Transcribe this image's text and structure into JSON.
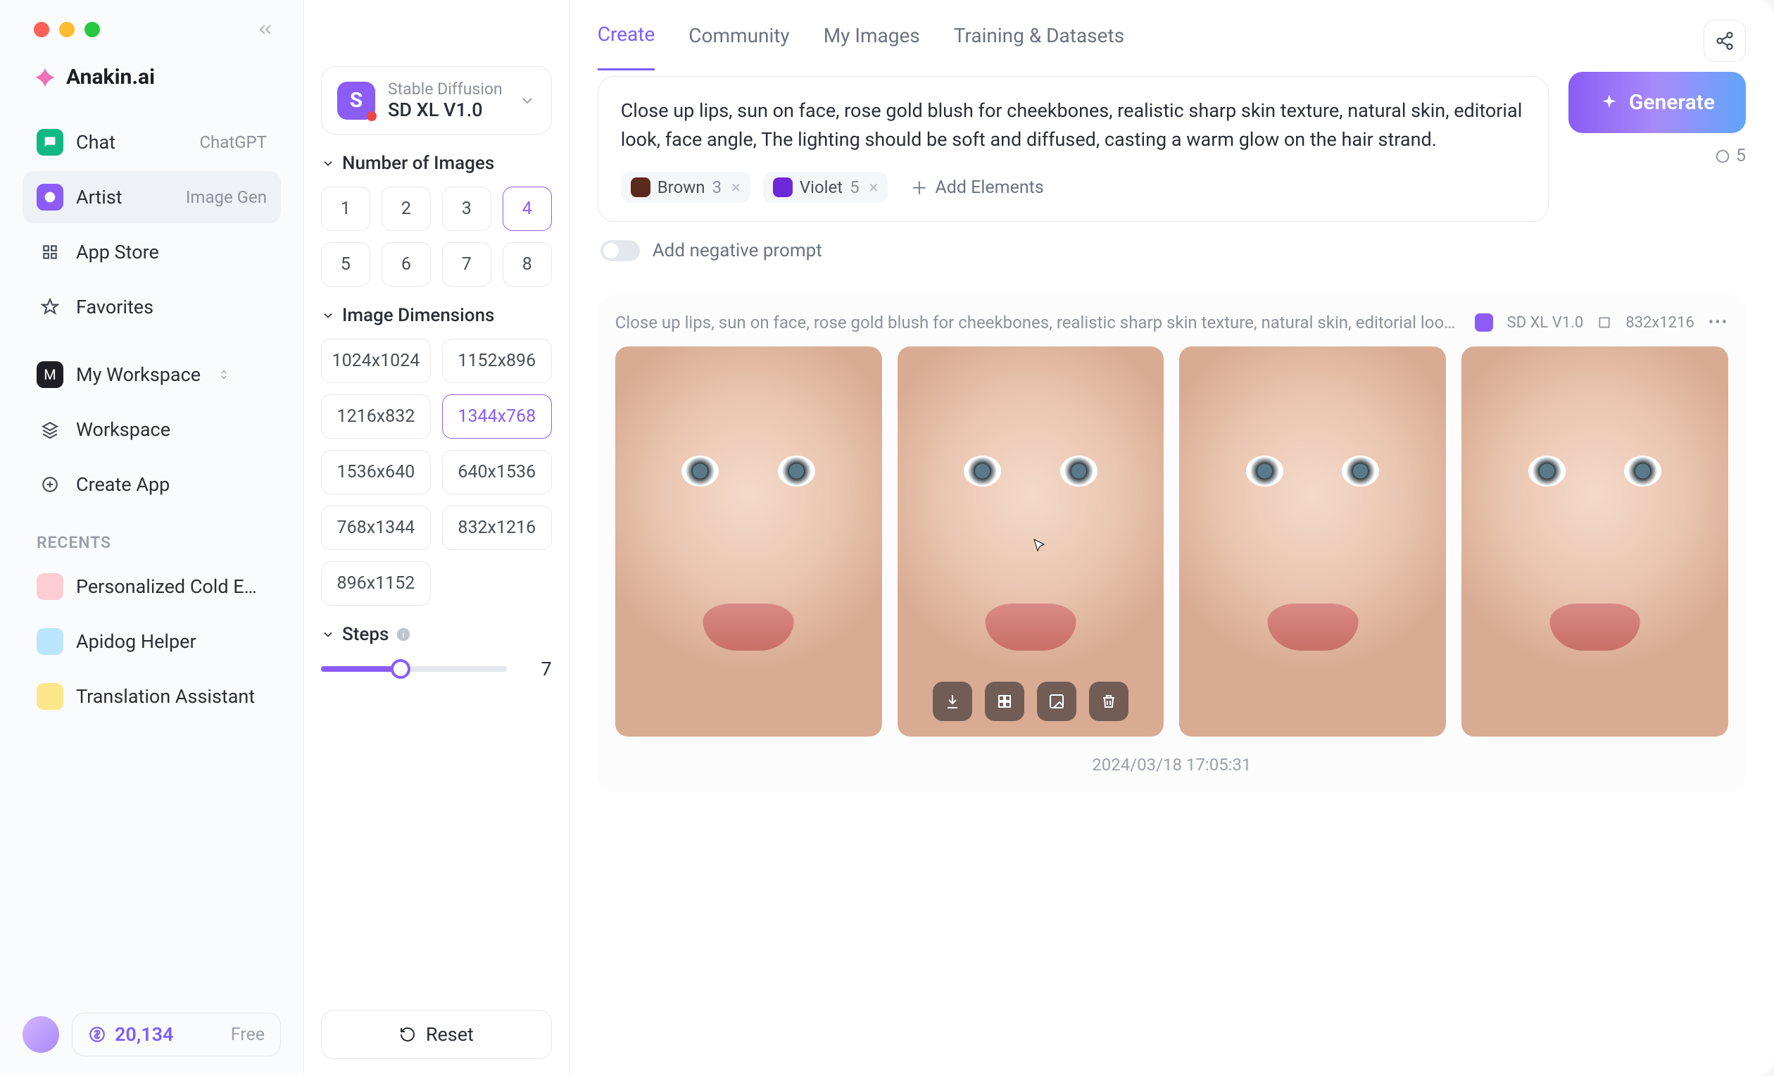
{
  "brand": "Anakin.ai",
  "sidebar": {
    "items": [
      {
        "icon": "chat",
        "label": "Chat",
        "badge": "ChatGPT",
        "active": false
      },
      {
        "icon": "artist",
        "label": "Artist",
        "badge": "Image Gen",
        "active": true
      },
      {
        "icon": "store",
        "label": "App Store",
        "badge": "",
        "active": false
      },
      {
        "icon": "fav",
        "label": "Favorites",
        "badge": "",
        "active": false
      }
    ],
    "workspace": [
      {
        "icon": "ws",
        "label": "My Workspace"
      },
      {
        "icon": "wsp",
        "label": "Workspace"
      },
      {
        "icon": "plus",
        "label": "Create App"
      }
    ],
    "recents_label": "RECENTS",
    "recents": [
      {
        "color": "#fca5a5",
        "label": "Personalized Cold Email Fro…"
      },
      {
        "color": "#7dd3fc",
        "label": "Apidog Helper"
      },
      {
        "color": "#fbbf24",
        "label": "Translation Assistant"
      }
    ],
    "credits": "20,134",
    "plan": "Free"
  },
  "tabs": [
    "Create",
    "Community",
    "My Images",
    "Training & Datasets"
  ],
  "active_tab": 0,
  "model": {
    "provider": "Stable Diffusion",
    "name": "SD XL V1.0"
  },
  "groups": {
    "num_images": {
      "title": "Number of Images",
      "options": [
        "1",
        "2",
        "3",
        "4",
        "5",
        "6",
        "7",
        "8"
      ],
      "selected": "4"
    },
    "dimensions": {
      "title": "Image Dimensions",
      "options": [
        "1024x1024",
        "1152x896",
        "1216x832",
        "1344x768",
        "1536x640",
        "640x1536",
        "768x1344",
        "832x1216",
        "896x1152"
      ],
      "selected": "1344x768"
    },
    "steps": {
      "title": "Steps",
      "value": 7,
      "min": 1,
      "max": 15
    }
  },
  "reset_label": "Reset",
  "prompt": "Close up lips, sun on face, rose gold blush for cheekbones, realistic sharp skin texture, natural skin, editorial look, face angle, The lighting should be soft and diffused, casting a warm glow on the hair strand.",
  "elements": [
    {
      "swatch": "#5b2a1e",
      "name": "Brown",
      "count": "3"
    },
    {
      "swatch": "#6d28d9",
      "name": "Violet",
      "count": "5"
    }
  ],
  "add_elements": "Add Elements",
  "neg_label": "Add negative prompt",
  "generate_label": "Generate",
  "gen_cost": "5",
  "result": {
    "prompt": "Close up lips, sun on face, rose gold blush for cheekbones, realistic sharp skin texture, natural skin, editorial look, face…",
    "model": "SD XL V1.0",
    "size": "832x1216",
    "timestamp": "2024/03/18 17:05:31"
  }
}
